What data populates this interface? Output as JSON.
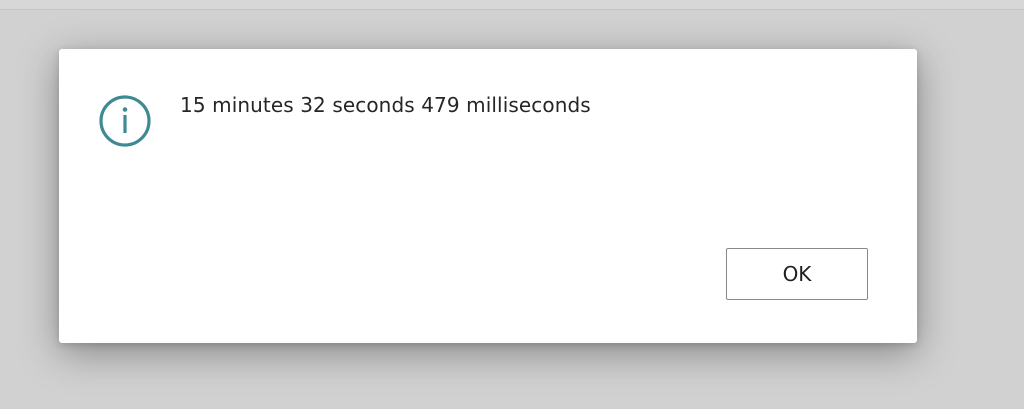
{
  "dialog": {
    "message": "15 minutes 32 seconds 479 milliseconds",
    "ok_label": "OK",
    "icon": "info-icon"
  },
  "colors": {
    "overlay": "#d1d1d1",
    "dialog_bg": "#ffffff",
    "icon_accent": "#3e8a92"
  }
}
